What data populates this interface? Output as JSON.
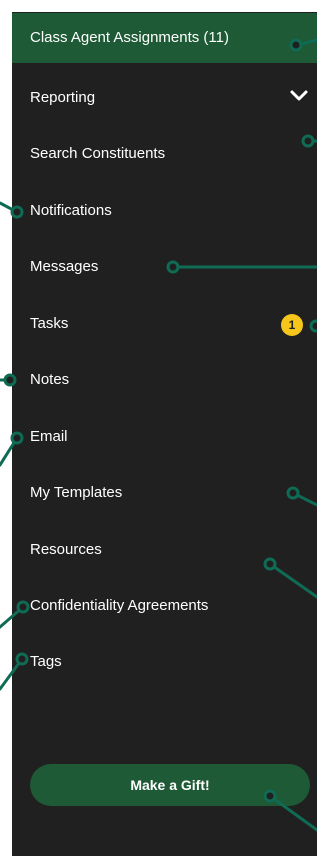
{
  "nav": {
    "items": [
      {
        "label": "Class Agent Assignments (11)"
      },
      {
        "label": "Reporting"
      },
      {
        "label": "Search Constituents"
      },
      {
        "label": "Notifications"
      },
      {
        "label": "Messages"
      },
      {
        "label": "Tasks"
      },
      {
        "label": "Notes"
      },
      {
        "label": "Email"
      },
      {
        "label": "My Templates"
      },
      {
        "label": "Resources"
      },
      {
        "label": "Confidentiality Agreements"
      },
      {
        "label": "Tags"
      }
    ],
    "tasks_badge": "1",
    "gift_button": "Make a Gift!"
  },
  "colors": {
    "background": "#202020",
    "accent": "#1d5a35",
    "badge": "#f6c71a",
    "callout": "#0f6b54"
  }
}
